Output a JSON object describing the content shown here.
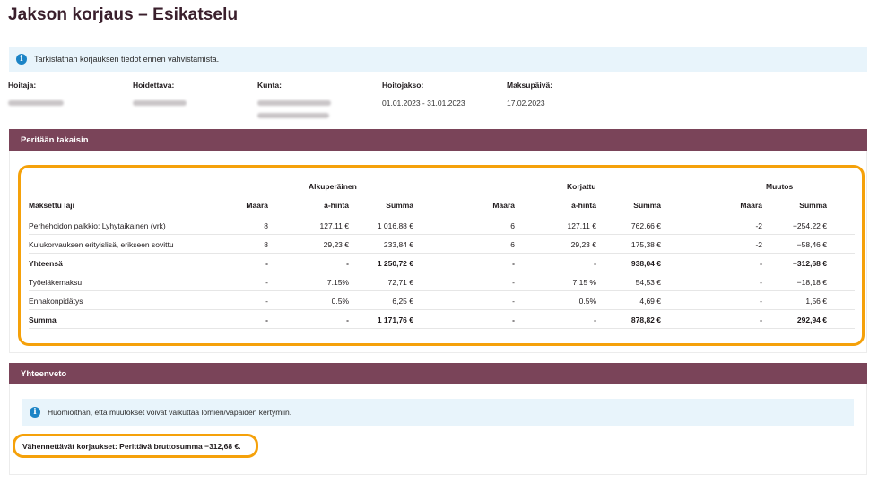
{
  "page": {
    "title": "Jakson korjaus – Esikatselu"
  },
  "info": {
    "text": "Tarkistathan korjauksen tiedot ennen vahvistamista."
  },
  "meta": {
    "hoitaja_label": "Hoitaja:",
    "hoidettava_label": "Hoidettava:",
    "kunta_label": "Kunta:",
    "hoitojakso_label": "Hoitojakso:",
    "hoitojakso_value": "01.01.2023 - 31.01.2023",
    "maksupaiva_label": "Maksupäivä:",
    "maksupaiva_value": "17.02.2023"
  },
  "section1": {
    "title": "Peritään takaisin"
  },
  "table": {
    "groups": {
      "original": "Alkuperäinen",
      "corrected": "Korjattu",
      "change": "Muutos"
    },
    "headers": {
      "type": "Maksettu laji",
      "orig_qty": "Määrä",
      "orig_price": "à-hinta",
      "orig_sum": "Summa",
      "corr_qty": "Määrä",
      "corr_price": "à-hinta",
      "corr_sum": "Summa",
      "chg_qty": "Määrä",
      "chg_sum": "Summa"
    },
    "rows": [
      {
        "type": "Perhehoidon palkkio: Lyhytaikainen (vrk)",
        "orig_qty": "8",
        "orig_price": "127,11 €",
        "orig_sum": "1 016,88 €",
        "corr_qty": "6",
        "corr_price": "127,11 €",
        "corr_sum": "762,66 €",
        "chg_qty": "-2",
        "chg_sum": "−254,22 €"
      },
      {
        "type": "Kulukorvauksen erityislisä, erikseen sovittu",
        "orig_qty": "8",
        "orig_price": "29,23 €",
        "orig_sum": "233,84 €",
        "corr_qty": "6",
        "corr_price": "29,23 €",
        "corr_sum": "175,38 €",
        "chg_qty": "-2",
        "chg_sum": "−58,46 €"
      },
      {
        "type": "Yhteensä",
        "orig_qty": "-",
        "orig_price": "-",
        "orig_sum": "1 250,72 €",
        "corr_qty": "-",
        "corr_price": "-",
        "corr_sum": "938,04 €",
        "chg_qty": "-",
        "chg_sum": "−312,68 €"
      },
      {
        "type": "Työeläkemaksu",
        "orig_qty": "-",
        "orig_price": "7.15%",
        "orig_sum": "72,71 €",
        "corr_qty": "-",
        "corr_price": "7.15 %",
        "corr_sum": "54,53 €",
        "chg_qty": "-",
        "chg_sum": "−18,18 €"
      },
      {
        "type": "Ennakonpidätys",
        "orig_qty": "-",
        "orig_price": "0.5%",
        "orig_sum": "6,25 €",
        "corr_qty": "-",
        "corr_price": "0.5%",
        "corr_sum": "4,69 €",
        "chg_qty": "-",
        "chg_sum": "1,56 €"
      },
      {
        "type": "Summa",
        "orig_qty": "-",
        "orig_price": "-",
        "orig_sum": "1 171,76 €",
        "corr_qty": "-",
        "corr_price": "-",
        "corr_sum": "878,82 €",
        "chg_qty": "-",
        "chg_sum": "292,94 €"
      }
    ]
  },
  "section2": {
    "title": "Yhteenveto"
  },
  "note": {
    "text": "Huomioithan, että muutokset voivat vaikuttaa lomien/vapaiden kertymiin."
  },
  "summary": {
    "text": "Vähennettävät korjaukset: Perittävä bruttosumma −312,68 €."
  },
  "colors": {
    "accent": "#7a4459",
    "highlight": "#f5a10a",
    "info": "#1c84c6",
    "info_bg": "#e8f4fb"
  }
}
